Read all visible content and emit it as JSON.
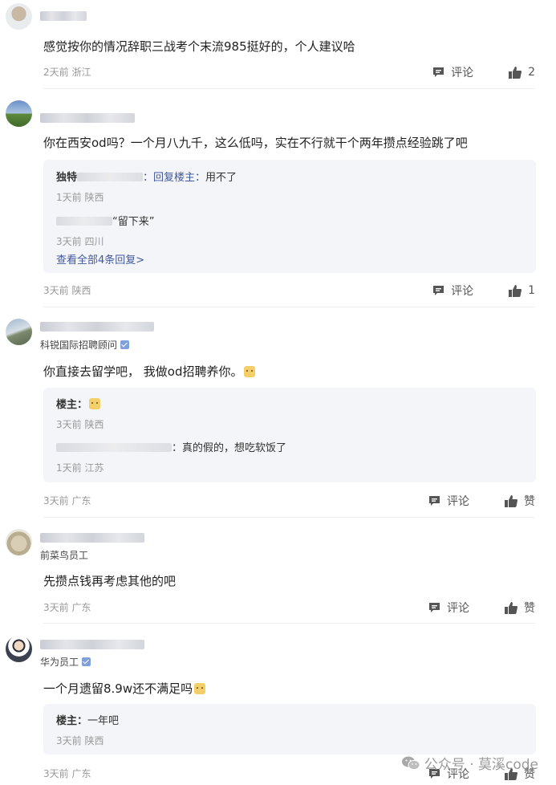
{
  "comments": [
    {
      "text": "感觉按你的情况辞职三战考个末流985挺好的，个人建议哈",
      "time": "2天前",
      "location": "浙江",
      "comment_label": "评论",
      "like_label": "2"
    },
    {
      "text": "你在西安od吗？一个月八九千，这么低吗，实在不行就干个两年攒点经验跳了吧",
      "replies": [
        {
          "name": "独特",
          "to": "：回复楼主：",
          "content": "用不了",
          "time": "1天前",
          "location": "陕西"
        },
        {
          "name": "",
          "to": "",
          "content": "“留下来”",
          "time": "3天前",
          "location": "四川"
        }
      ],
      "more_label": "查看全部4条回复>",
      "time": "3天前",
      "location": "陕西",
      "comment_label": "评论",
      "like_label": "1"
    },
    {
      "role": "科锐国际招聘顾问",
      "text": "你直接去留学吧， 我做od招聘养你。",
      "replies": [
        {
          "name": "楼主：",
          "to": "",
          "content": "",
          "time": "3天前",
          "location": "陕西"
        },
        {
          "name": "",
          "to": "",
          "content": "：真的假的，想吃软饭了",
          "time": "1天前",
          "location": "江苏"
        }
      ],
      "time": "3天前",
      "location": "广东",
      "comment_label": "评论",
      "like_label": "赞"
    },
    {
      "role": "前菜鸟员工",
      "text": "先攒点钱再考虑其他的吧",
      "time": "3天前",
      "location": "广东",
      "comment_label": "评论",
      "like_label": "赞"
    },
    {
      "role": "华为员工",
      "text": "一个月遗留8.9w还不满足吗",
      "replies": [
        {
          "name": "楼主：",
          "to": "",
          "content": "一年吧",
          "time": "3天前",
          "location": "陕西"
        }
      ],
      "time": "3天前",
      "location": "广东",
      "comment_label": "评论",
      "like_label": "赞"
    }
  ],
  "watermark": "公众号 · 莫溪code",
  "colors": {
    "link": "#40599b",
    "reply_bg": "#f4f5f9",
    "meta": "#999999"
  }
}
